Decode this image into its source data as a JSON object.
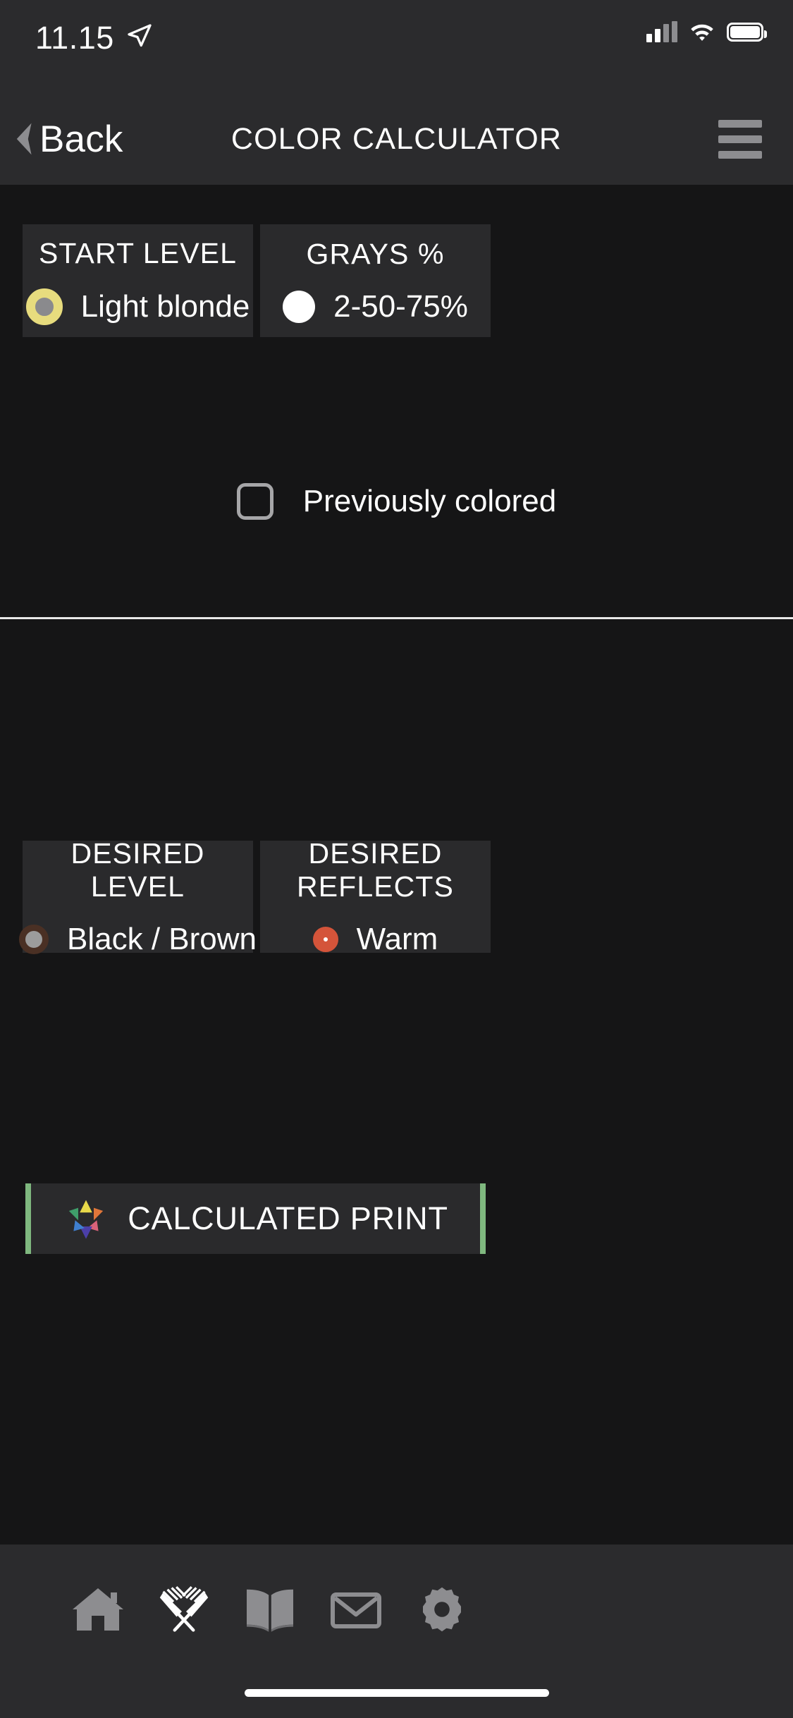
{
  "status_bar": {
    "time": "11.15",
    "location_icon": "location-arrow-icon",
    "cellular_icon": "cellular-signal-icon",
    "wifi_icon": "wifi-icon",
    "battery_icon": "battery-full-icon"
  },
  "nav": {
    "back_label": "Back",
    "back_icon": "chevron-left-icon",
    "title": "COLOR CALCULATOR",
    "menu_icon": "hamburger-menu-icon"
  },
  "section_start": {
    "cards": [
      {
        "title": "START LEVEL",
        "value": "Light blonde",
        "swatch_icon": "color-swatch-light-blonde",
        "swatch_ring_color": "#E7DC7E",
        "swatch_center_color": "#8A8A8D"
      },
      {
        "title": "GRAYS %",
        "value": "2-50-75%",
        "swatch_icon": "color-swatch-grays",
        "swatch_ring_color": "#FFFFFF",
        "swatch_center_color": "#FFFFFF"
      }
    ],
    "checkbox": {
      "label": "Previously colored",
      "checked": false,
      "icon": "checkbox-unchecked-icon"
    }
  },
  "section_desired": {
    "cards": [
      {
        "title": "DESIRED LEVEL",
        "value": "Black / Brown",
        "swatch_icon": "color-swatch-black-brown",
        "swatch_ring_color": "#4A3024",
        "swatch_center_color": "#9C9C9C"
      },
      {
        "title": "DESIRED REFLECTS",
        "value": "Warm",
        "swatch_icon": "color-swatch-warm",
        "swatch_ring_color": "#D4543A",
        "swatch_center_color": "#FFFFFF"
      }
    ]
  },
  "calculate_button": {
    "label": "CALCULATED PRINT",
    "icon": "color-star-icon",
    "accent_color": "#7FB87F"
  },
  "tabbar": {
    "items": [
      {
        "icon": "home-icon",
        "active": false
      },
      {
        "icon": "crossed-color-combs-icon",
        "active": true
      },
      {
        "icon": "open-book-icon",
        "active": false
      },
      {
        "icon": "envelope-icon",
        "active": false
      },
      {
        "icon": "gear-icon",
        "active": false
      }
    ]
  },
  "colors": {
    "background": "#151516",
    "bar_background": "#2B2B2D",
    "card_background": "#2A2A2C",
    "text_primary": "#FFFFFF",
    "icon_inactive": "#8D8D90",
    "icon_active": "#FFFFFF",
    "divider": "#E8E8E8"
  }
}
